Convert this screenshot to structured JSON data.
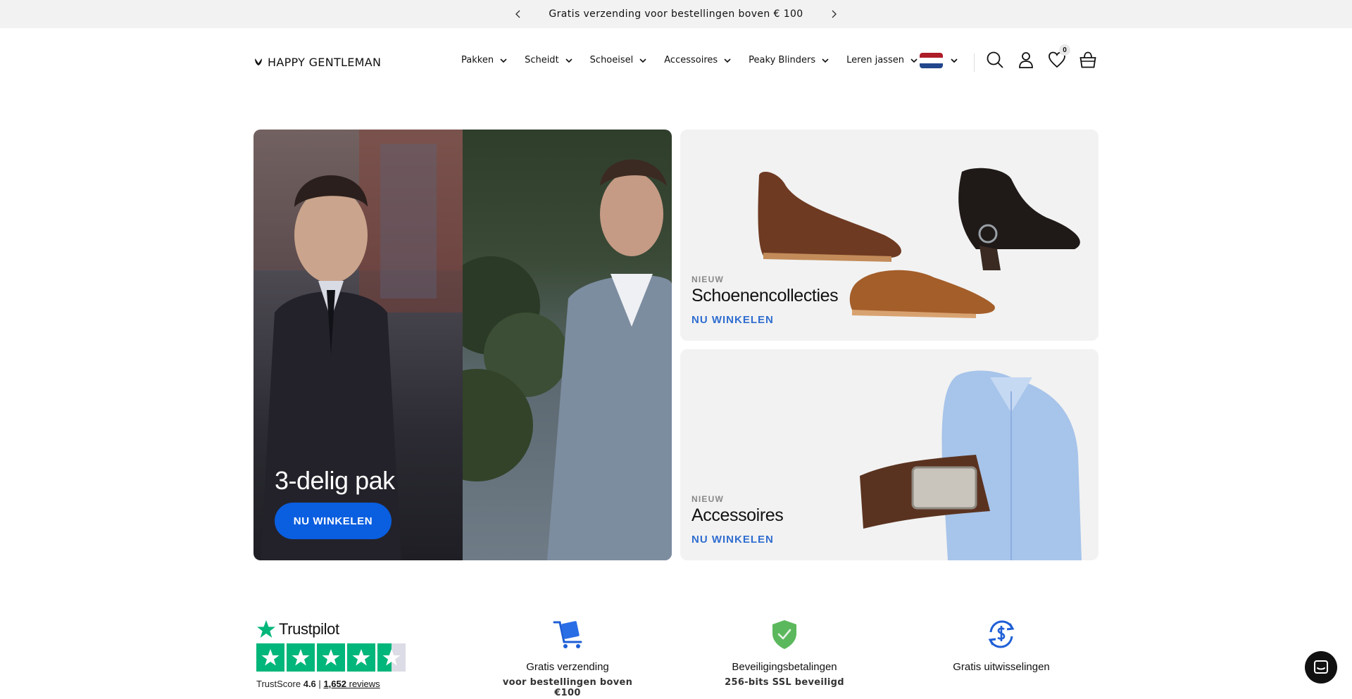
{
  "announcement": {
    "message": "Gratis verzending voor bestellingen boven € 100",
    "prev_icon": "chevron-left-icon",
    "next_icon": "chevron-right-icon"
  },
  "header": {
    "logo_text": "HAPPY GENTLEMAN",
    "nav": [
      {
        "label": "Pakken"
      },
      {
        "label": "Scheidt"
      },
      {
        "label": "Schoeisel"
      },
      {
        "label": "Accessoires"
      },
      {
        "label": "Peaky Blinders"
      },
      {
        "label": "Leren jassen"
      }
    ],
    "language_flag": "netherlands-flag-icon",
    "wishlist_count": "0",
    "icons": [
      "search-icon",
      "account-icon",
      "heart-icon",
      "basket-icon"
    ]
  },
  "hero": {
    "title": "3-delig pak",
    "button_label": "NU WINKELEN"
  },
  "cards": [
    {
      "eyebrow": "NIEUW",
      "title": "Schoenencollecties",
      "link": "NU WINKELEN"
    },
    {
      "eyebrow": "NIEUW",
      "title": "Accessoires",
      "link": "NU WINKELEN"
    }
  ],
  "trustpilot": {
    "brand": "Trustpilot",
    "score_label": "TrustScore",
    "score": "4.6",
    "separator": "|",
    "reviews_count": "1,652",
    "reviews_label": "reviews"
  },
  "features": [
    {
      "icon": "shipping-box-icon",
      "title": "Gratis verzending",
      "subtitle": "voor bestellingen boven €100"
    },
    {
      "icon": "shield-check-icon",
      "title": "Beveiligingsbetalingen",
      "subtitle": "256-bits SSL beveiligd"
    },
    {
      "icon": "money-exchange-icon",
      "title": "Gratis uitwisselingen",
      "subtitle": ""
    }
  ],
  "colors": {
    "accent_blue": "#0a5ee0",
    "link_blue": "#2f6dd0",
    "trustpilot_green": "#00b67a",
    "shield_green": "#5cb85c"
  }
}
